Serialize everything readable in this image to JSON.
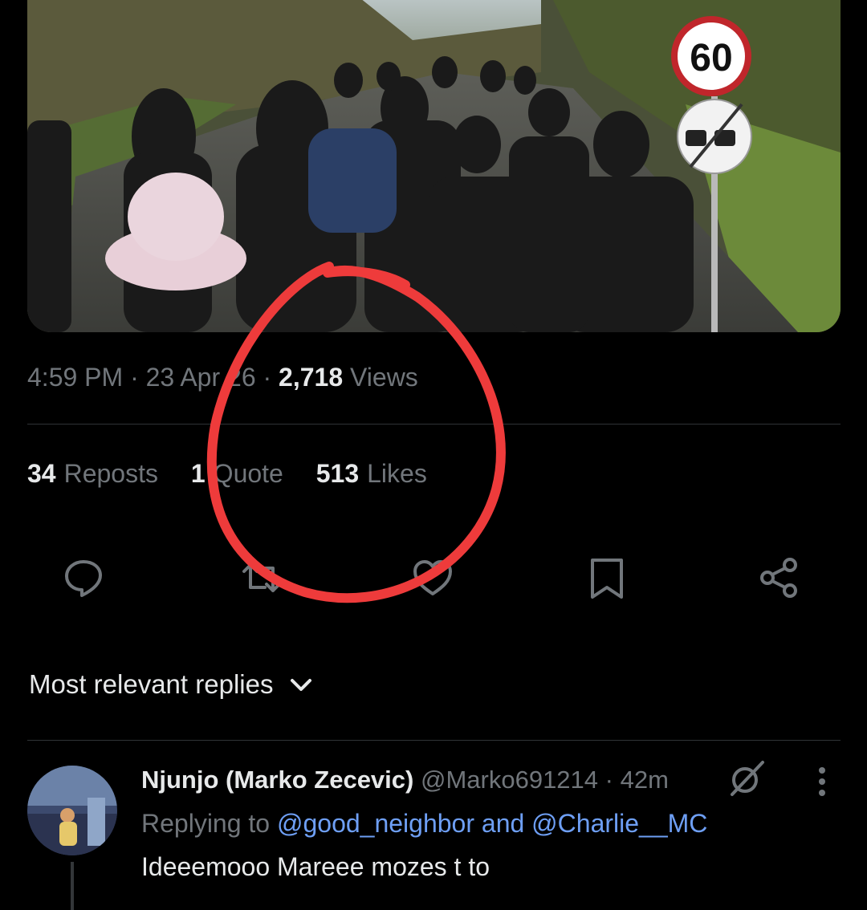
{
  "tweet": {
    "time": "4:59 PM",
    "date": "23 Apr 26",
    "views_count": "2,718",
    "views_label": "Views",
    "sep": "·",
    "photo_sign_speed": "60"
  },
  "stats": {
    "reposts_count": "34",
    "reposts_label": "Reposts",
    "quotes_count": "1",
    "quotes_label": "Quote",
    "likes_count": "513",
    "likes_label": "Likes"
  },
  "actions": {
    "icons": [
      "reply-icon",
      "repost-icon",
      "like-icon",
      "bookmark-icon",
      "share-icon"
    ]
  },
  "replies": {
    "header_label": "Most relevant replies"
  },
  "reply": {
    "name": "Njunjo (Marko Zecevic)",
    "handle": "@Marko691214",
    "sep": "·",
    "age": "42m",
    "replying_prefix": "Replying to",
    "mention_1": "@good_neighbor",
    "and": "and",
    "mention_2": "@Charlie__MC",
    "text": "Ideeemooo Mareee mozes t to"
  },
  "colors": {
    "background": "#000000",
    "text": "#e7e9ea",
    "muted": "#71767b",
    "mention": "#6e9ff5",
    "annotation": "#ee3b3b"
  }
}
